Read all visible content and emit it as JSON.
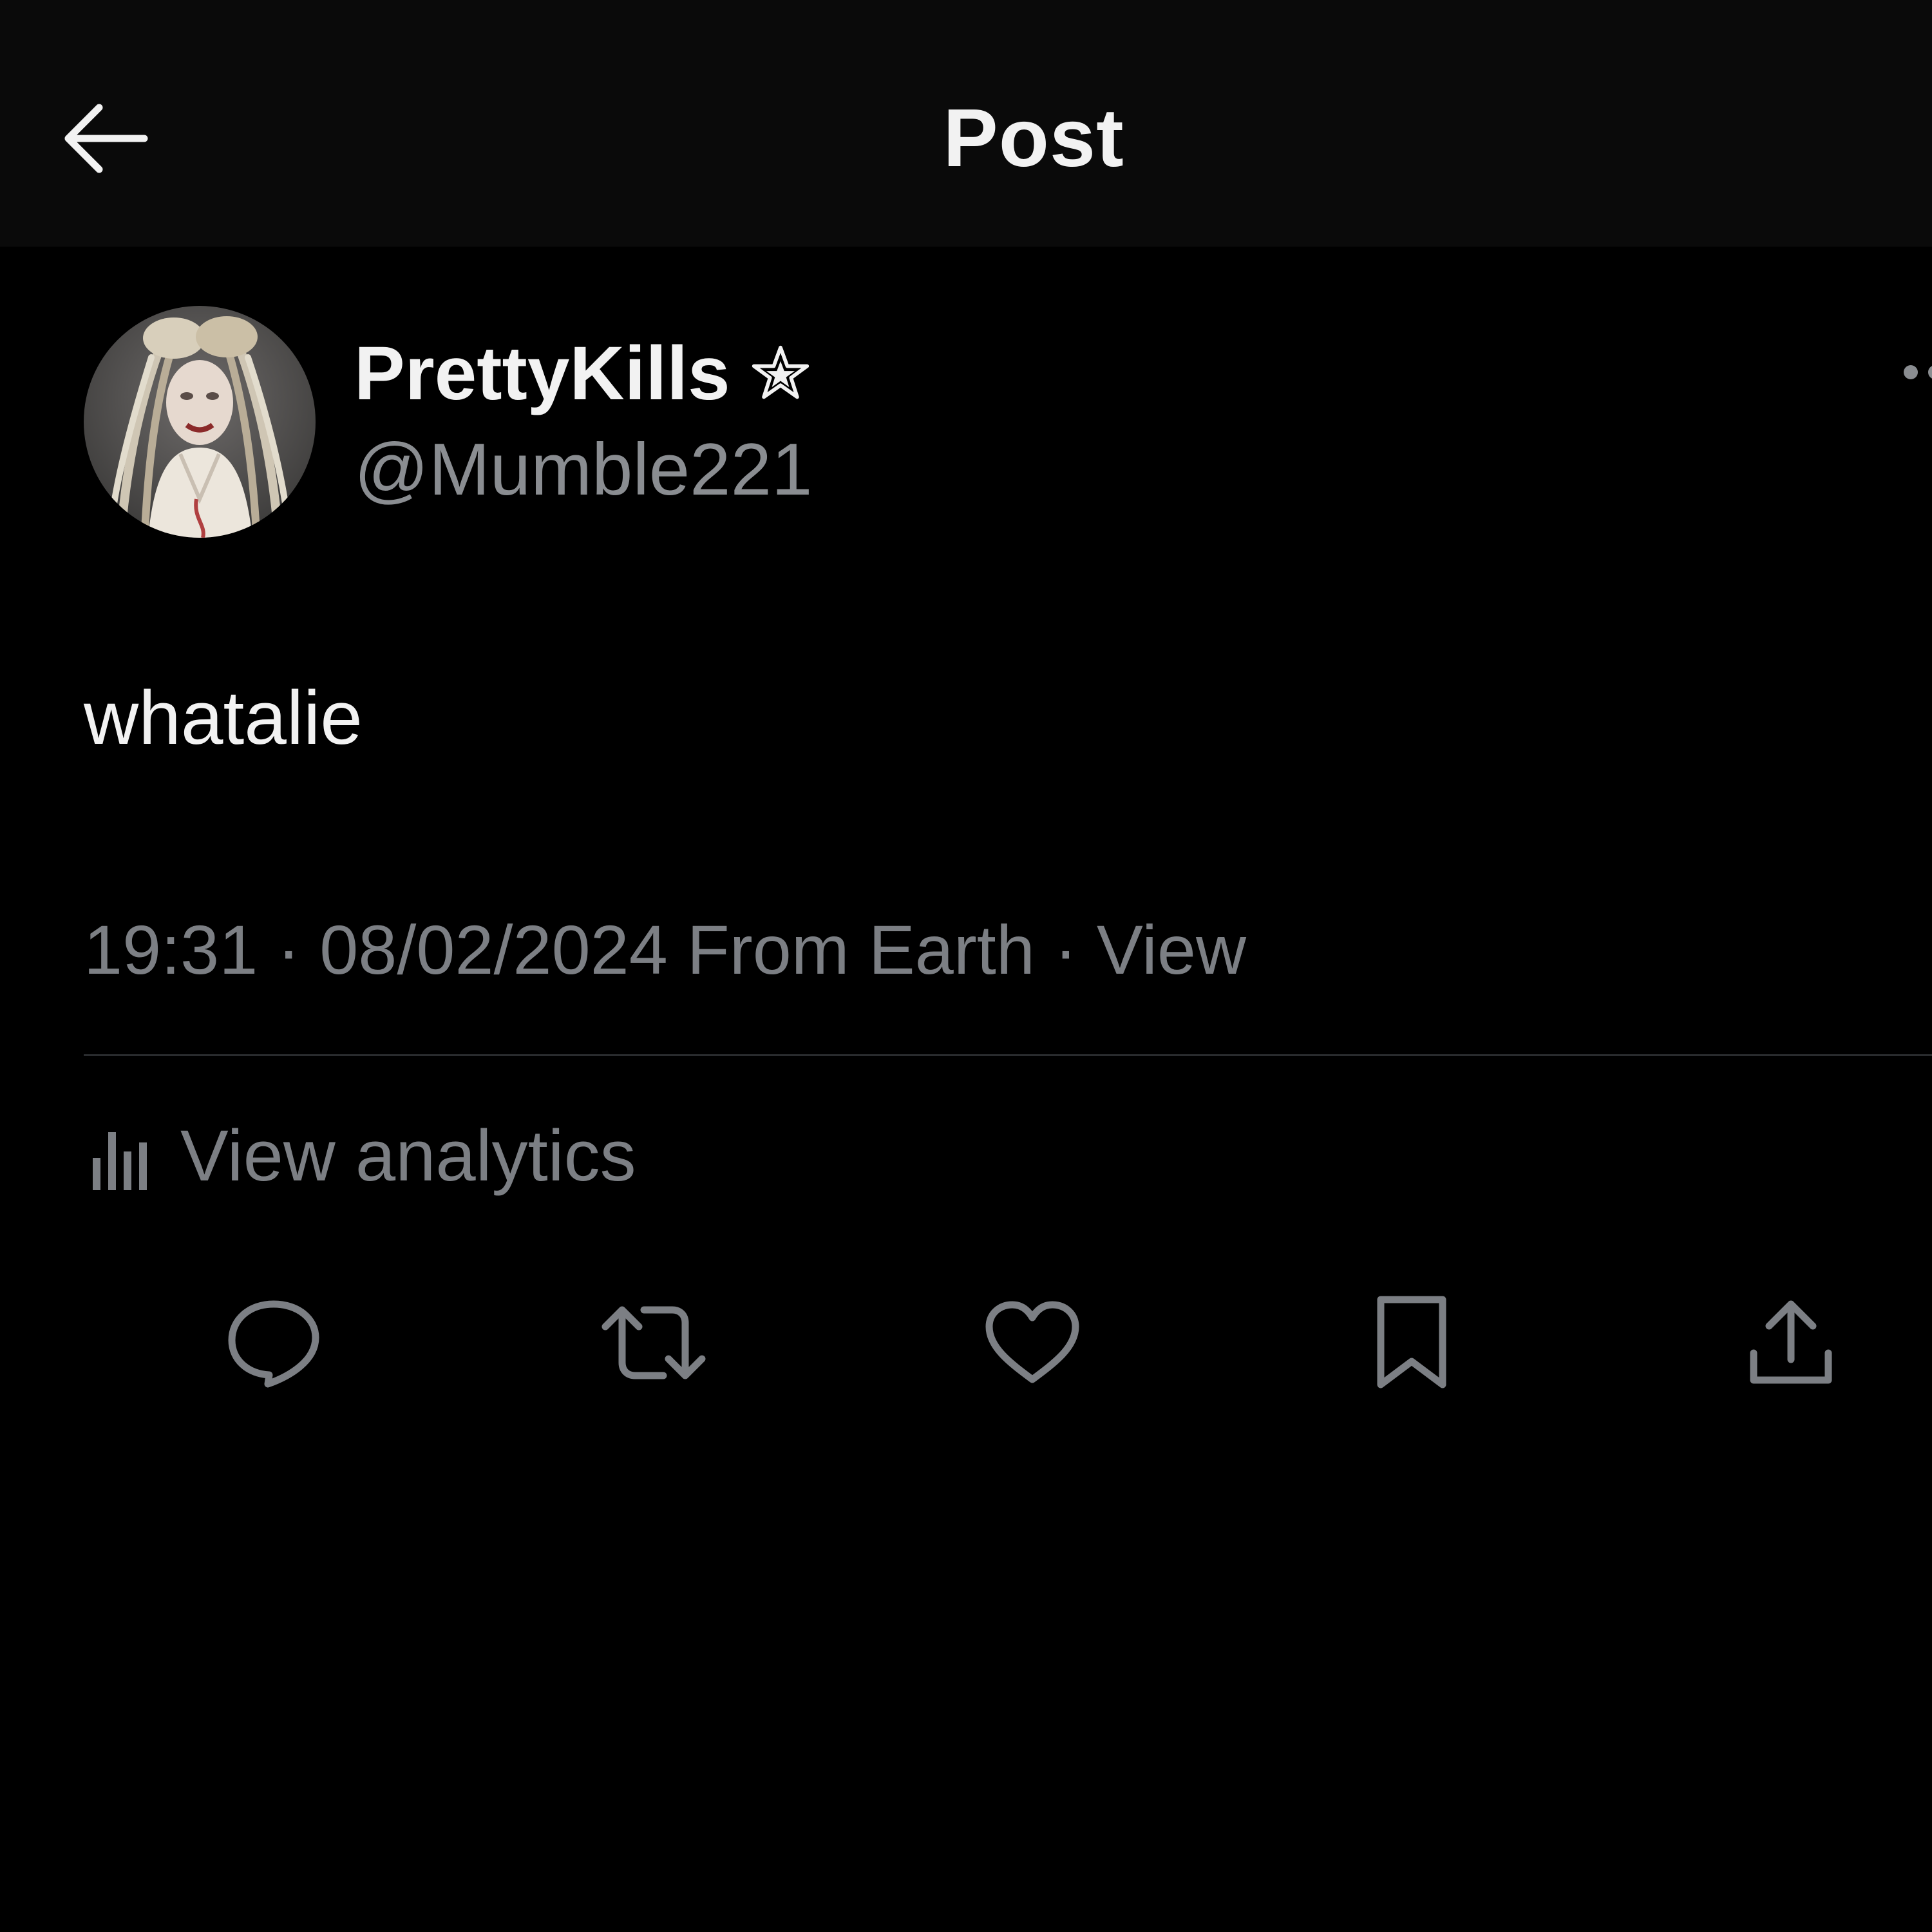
{
  "header": {
    "title": "Post",
    "back_icon": "arrow-left-icon"
  },
  "author": {
    "display_name": "PrettyKills",
    "badge_icon": "star-outline-icon",
    "handle": "@Mumble221",
    "avatar": "avatar-photo",
    "more_icon": "more-dots-icon"
  },
  "post": {
    "text": "whatalie",
    "meta": "19:31 · 08/02/2024 From Earth · View"
  },
  "analytics": {
    "icon": "bar-chart-icon",
    "label": "View analytics"
  },
  "actions": {
    "items": [
      {
        "icon": "reply-icon"
      },
      {
        "icon": "repost-icon"
      },
      {
        "icon": "like-icon"
      },
      {
        "icon": "bookmark-icon"
      },
      {
        "icon": "share-icon"
      }
    ]
  },
  "colors": {
    "background": "#000000",
    "topbar": "#0a0a0a",
    "primary_text": "#f2f2f2",
    "secondary_text": "#7c7f84",
    "divider": "#2a2c2f"
  }
}
